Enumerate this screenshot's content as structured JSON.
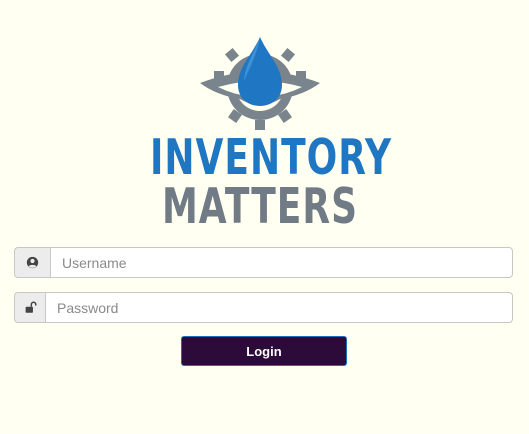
{
  "logo": {
    "line1": "INVENTORY",
    "line2": "MATTERS",
    "icon": "water-drop-gear-logo"
  },
  "form": {
    "username": {
      "icon": "user-icon",
      "placeholder": "Username",
      "value": ""
    },
    "password": {
      "icon": "unlock-icon",
      "placeholder": "Password",
      "value": ""
    },
    "login_label": "Login"
  },
  "colors": {
    "background": "#fffff2",
    "brand_blue": "#1f76c2",
    "brand_gray": "#717b85",
    "button_bg": "#2c0a3a"
  }
}
